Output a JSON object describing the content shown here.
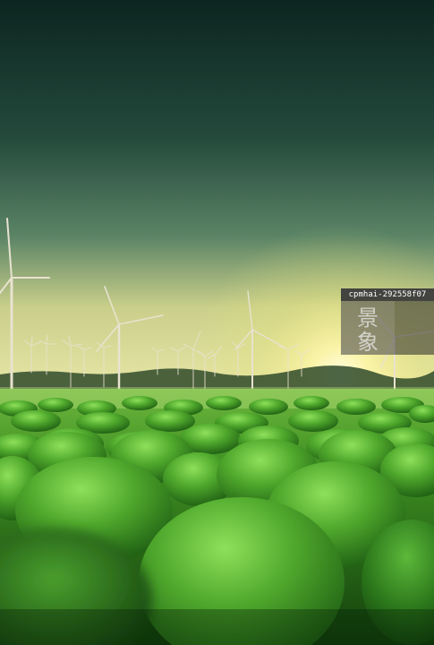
{
  "watermark": {
    "id_text": "cpmhai-292558f07",
    "logo_text": "景象"
  },
  "colors": {
    "sky_top": "#0e2a24",
    "sky_mid": "#3f6a55",
    "horizon_glow": "#fff4b0",
    "grass_dark": "#1f6b16",
    "grass_light": "#7cd24a"
  },
  "icons": [
    "wind-turbine-icon"
  ]
}
